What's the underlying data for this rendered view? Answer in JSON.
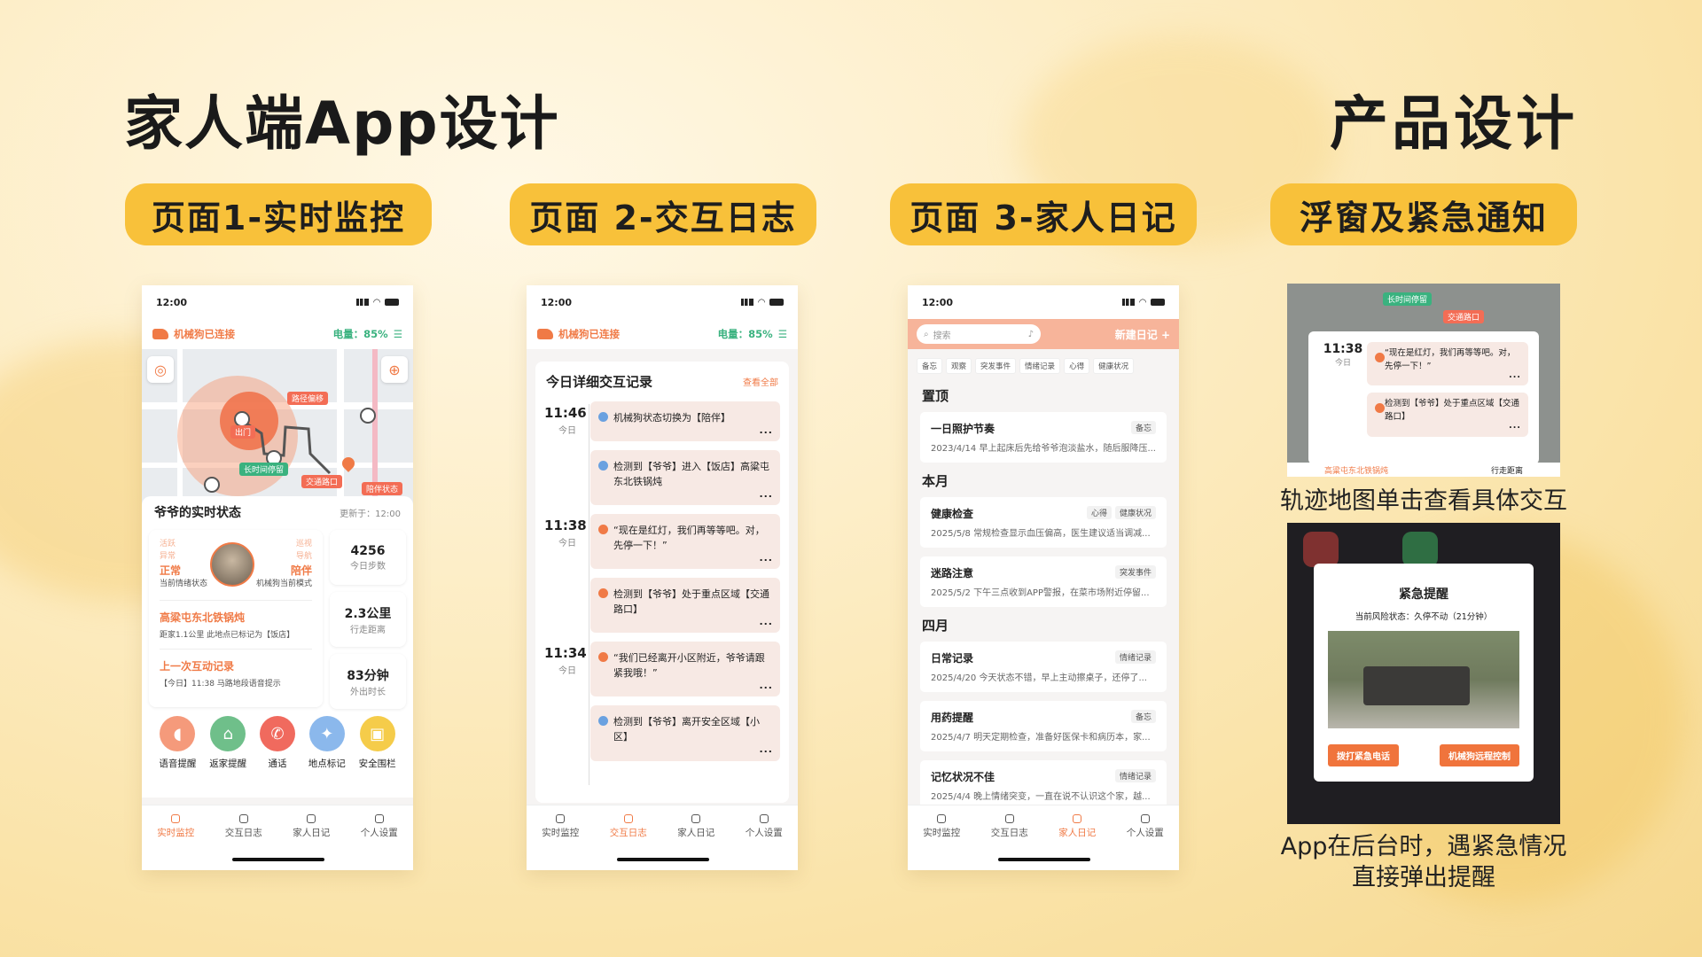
{
  "header": {
    "title_left": "家人端App设计",
    "title_right": "产品设计"
  },
  "pills": [
    "页面1-实时监控",
    "页面 2-交互日志",
    "页面 3-家人日记",
    "浮窗及紧急通知"
  ],
  "status_time": "12:00",
  "conn": {
    "left": "机械狗已连接",
    "right": "电量：85%"
  },
  "nav": [
    "实时监控",
    "交互日志",
    "家人日记",
    "个人设置"
  ],
  "p1": {
    "map_tags": [
      "路径偏移",
      "出门",
      "长时间停留",
      "交通路口",
      "陪伴状态"
    ],
    "status_title": "爷爷的实时状态",
    "updated": "更新于：12:00",
    "emotion_opts": [
      "活跃",
      "异常"
    ],
    "emotion_val": "正常",
    "emotion_label": "当前情绪状态",
    "mode_opts": [
      "巡视",
      "导航"
    ],
    "mode_val": "陪伴",
    "mode_label": "机械狗当前模式",
    "stats": [
      {
        "value": "4256",
        "label": "今日步数"
      },
      {
        "value": "2.3公里",
        "label": "行走距离"
      },
      {
        "value": "83分钟",
        "label": "外出时长"
      }
    ],
    "loc_title": "高粱屯东北铁锅炖",
    "loc_sub": "距家1.1公里  此地点已标记为【饭店】",
    "last_title": "上一次互动记录",
    "last_sub": "【今日】11:38 马路地段语音提示",
    "actions": [
      "语音提醒",
      "返家提醒",
      "通话",
      "地点标记",
      "安全围栏"
    ]
  },
  "p2": {
    "title": "今日详细交互记录",
    "view_all": "查看全部",
    "today": "今日",
    "groups": [
      {
        "time": "11:46",
        "cards": [
          {
            "text": "机械狗状态切换为【陪伴】",
            "color": "blue"
          },
          {
            "text": "检测到【爷爷】进入【饭店】高粱屯东北铁锅炖",
            "color": "blue"
          }
        ]
      },
      {
        "time": "11:38",
        "cards": [
          {
            "text": "“现在是红灯，我们再等等吧。对，先停一下！”",
            "color": "orange"
          },
          {
            "text": "检测到【爷爷】处于重点区域【交通路口】",
            "color": "orange"
          }
        ]
      },
      {
        "time": "11:34",
        "cards": [
          {
            "text": "“我们已经离开小区附近，爷爷请跟紧我哦！”",
            "color": "orange"
          },
          {
            "text": "检测到【爷爷】离开安全区域【小区】",
            "color": "blue"
          }
        ]
      }
    ]
  },
  "p3": {
    "search_placeholder": "搜索",
    "new_label": "新建日记 +",
    "filters": [
      "备忘",
      "观察",
      "突发事件",
      "情绪记录",
      "心得",
      "健康状况"
    ],
    "sections": [
      {
        "name": "置顶",
        "items": [
          {
            "title": "一日照护节奏",
            "tags": [
              "备忘"
            ],
            "meta": "2023/4/14 早上起床后先给爷爷泡淡盐水，随后服降压..."
          }
        ]
      },
      {
        "name": "本月",
        "items": [
          {
            "title": "健康检查",
            "tags": [
              "健康状况",
              "心得"
            ],
            "meta": "2025/5/8 常规检查显示血压偏高，医生建议适当调减..."
          },
          {
            "title": "迷路注意",
            "tags": [
              "突发事件"
            ],
            "meta": "2025/5/2 下午三点收到APP警报，在菜市场附近停留..."
          }
        ]
      },
      {
        "name": "四月",
        "items": [
          {
            "title": "日常记录",
            "tags": [
              "情绪记录"
            ],
            "meta": "2025/4/20 今天状态不错，早上主动擦桌子，还停了..."
          },
          {
            "title": "用药提醒",
            "tags": [
              "备忘"
            ],
            "meta": "2025/4/7 明天定期检查，准备好医保卡和病历本，家..."
          },
          {
            "title": "记忆状况不佳",
            "tags": [
              "情绪记录"
            ],
            "meta": "2025/4/4 晚上情绪突变，一直在说不认识这个家，越..."
          }
        ]
      }
    ]
  },
  "p4": {
    "popup_time": "11:38",
    "popup_today": "今日",
    "popup_msg1": "“现在是红灯，我们再等等吧。对，先停一下！”",
    "popup_msg2": "检测到【爷爷】处于重点区域【交通路口】",
    "popup_bottom_left": "高粱屯东北铁锅炖",
    "popup_bottom_right": "行走距离",
    "caption1": "轨迹地图单击查看具体交互",
    "alert_title": "紧急提醒",
    "alert_status": "当前风险状态：久停不动（21分钟）",
    "alert_btn1": "拨打紧急电话",
    "alert_btn2": "机械狗远程控制",
    "caption2_l1": "App在后台时，遇紧急情况",
    "caption2_l2": "直接弹出提醒"
  },
  "colors": {
    "accent": "#f07a46",
    "pill": "#f8c13a",
    "alert": "#f0743c"
  }
}
